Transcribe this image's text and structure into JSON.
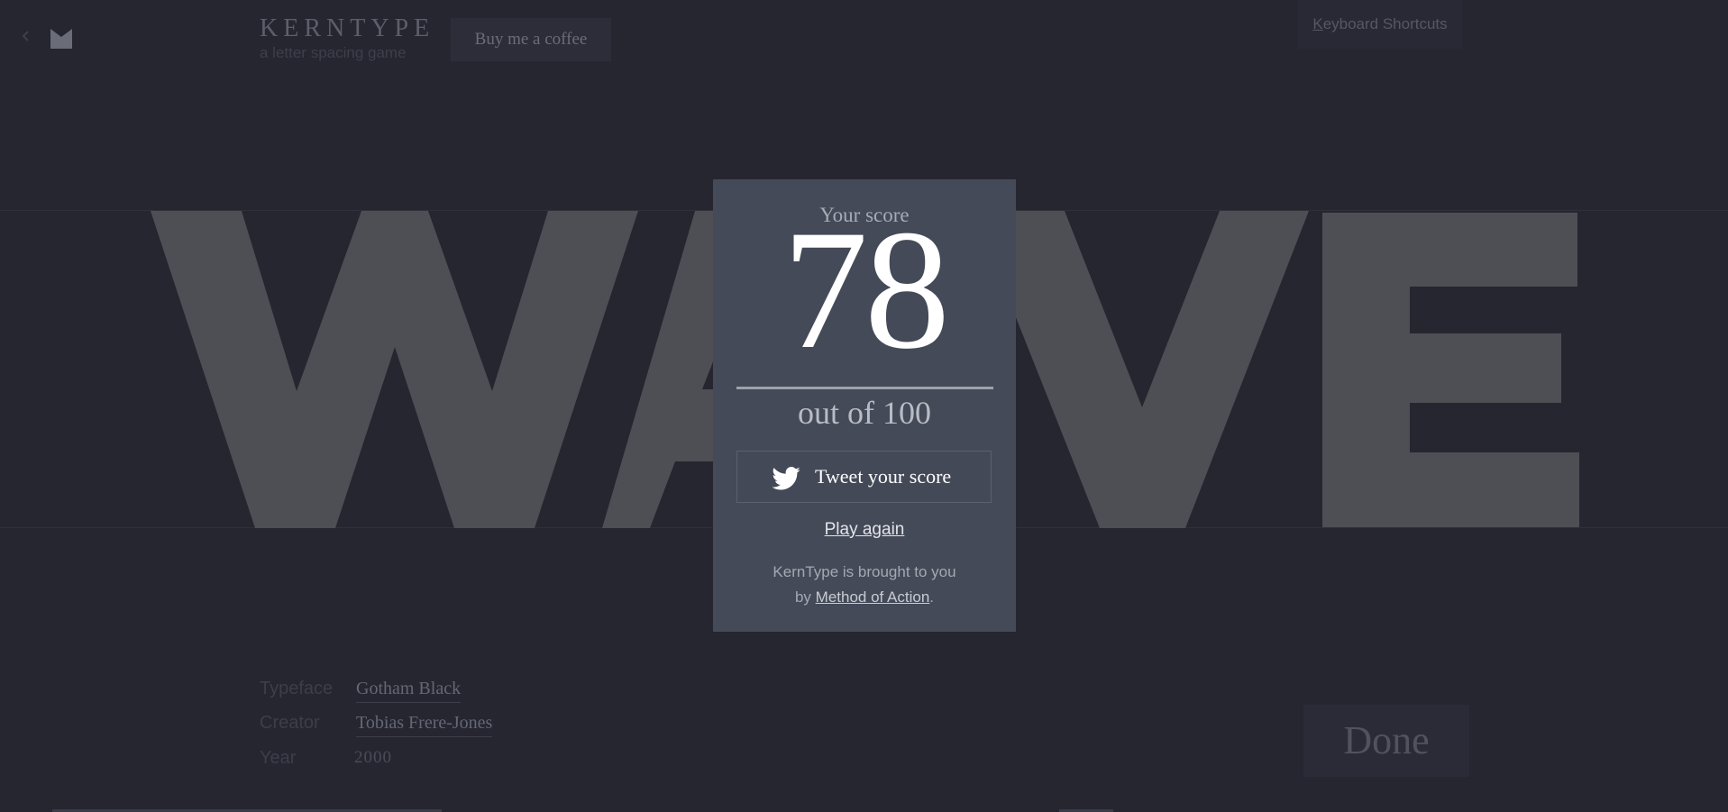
{
  "header": {
    "brand_title": "KERNTYPE",
    "brand_subtitle": "a letter spacing game",
    "coffee_label": "Buy me a coffee",
    "shortcuts_first_letter": "K",
    "shortcuts_rest": "eyboard Shortcuts"
  },
  "game": {
    "word_letters": [
      "W",
      "A",
      "V",
      "E"
    ]
  },
  "modal": {
    "score_label": "Your score",
    "score_value": "78",
    "score_out_of": "out of 100",
    "tweet_label": "Tweet your score",
    "play_again_label": "Play again",
    "credit_line1": "KernType is brought to you",
    "credit_by": "by ",
    "credit_link": "Method of Action",
    "credit_period": "."
  },
  "info": {
    "typeface_label": "Typeface",
    "typeface_value": "Gotham Black",
    "creator_label": "Creator",
    "creator_value": "Tobias Frere-Jones",
    "year_label": "Year",
    "year_value": "2000"
  },
  "done_label": "Done",
  "colors": {
    "background": "#252630",
    "letters": "#4e4e55",
    "modal": "#454a58"
  },
  "icons": [
    "chevron-left-icon",
    "kerntype-logo-icon",
    "twitter-bird-icon"
  ]
}
